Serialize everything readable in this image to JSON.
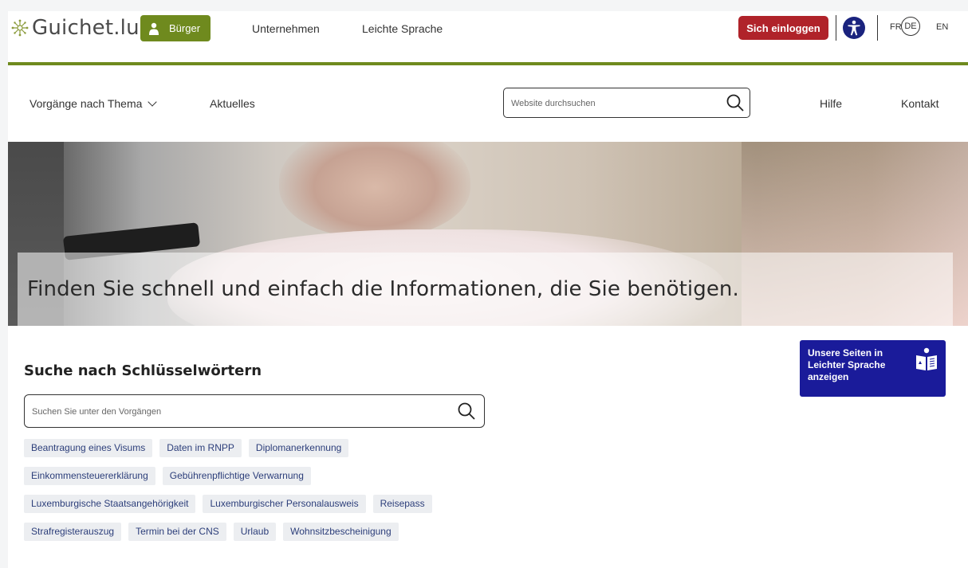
{
  "header": {
    "logo_text": "Guichet.lu",
    "audience_button": "Bürger",
    "nav": [
      "Unternehmen",
      "Leichte Sprache"
    ],
    "login_button": "Sich einloggen",
    "languages": {
      "fr": "FR",
      "de": "DE",
      "en": "EN"
    },
    "brand_green": "#6f8a1e",
    "login_red": "#b0232a"
  },
  "subnav": {
    "themes": "Vorgänge nach Thema",
    "news": "Aktuelles",
    "search_placeholder": "Website durchsuchen",
    "help": "Hilfe",
    "contact": "Kontakt"
  },
  "hero": {
    "title": "Finden Sie schnell und einfach die Informationen, die Sie benötigen."
  },
  "keywords": {
    "title": "Suche nach Schlüsselwörtern",
    "search_placeholder": "Suchen Sie unter den Vorgängen",
    "tag_rows": [
      [
        "Beantragung eines Visums",
        "Daten im RNPP",
        "Diplomanerkennung"
      ],
      [
        "Einkommensteuererklärung",
        "Gebührenpflichtige Verwarnung"
      ],
      [
        "Luxemburgische Staatsangehörigkeit",
        "Luxemburgischer Personalausweis",
        "Reisepass"
      ],
      [
        "Strafregisterauszug",
        "Termin bei der CNS",
        "Urlaub",
        "Wohnsitzbescheinigung"
      ]
    ]
  },
  "easy_language": {
    "text": "Unsere Seiten in Leichter Sprache anzeigen",
    "color": "#1a1b9a"
  }
}
